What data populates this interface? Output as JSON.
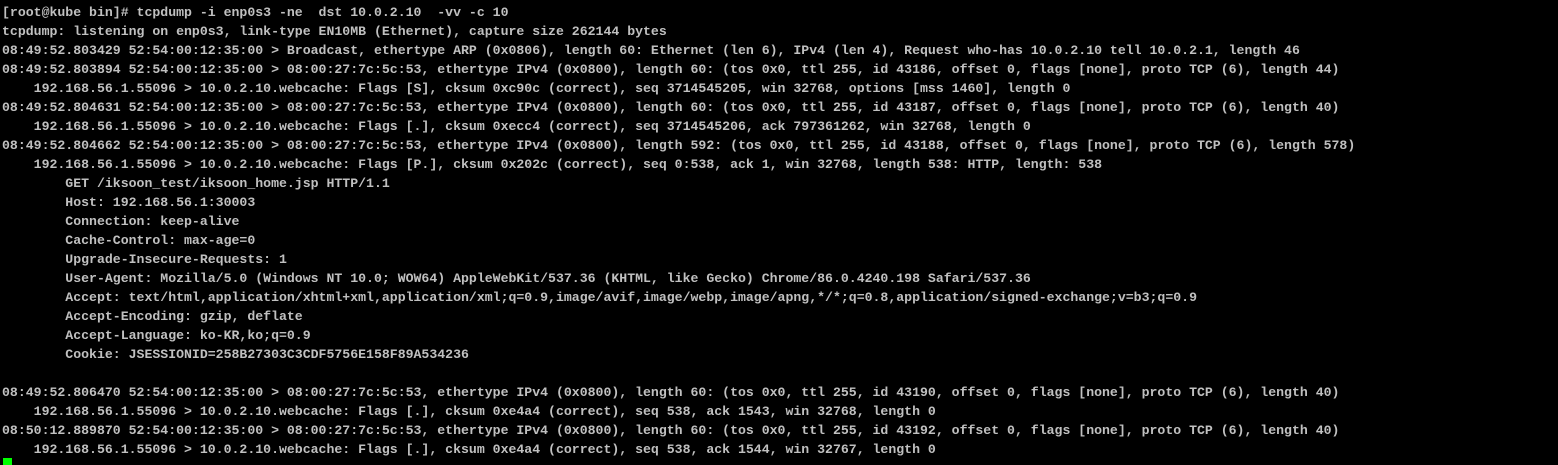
{
  "terminal": {
    "colors": {
      "background": "#000000",
      "foreground": "#c0c0c0",
      "cursor": "#00ff00"
    },
    "lines": [
      "[root@kube bin]# tcpdump -i enp0s3 -ne  dst 10.0.2.10  -vv -c 10",
      "tcpdump: listening on enp0s3, link-type EN10MB (Ethernet), capture size 262144 bytes",
      "08:49:52.803429 52:54:00:12:35:00 > Broadcast, ethertype ARP (0x0806), length 60: Ethernet (len 6), IPv4 (len 4), Request who-has 10.0.2.10 tell 10.0.2.1, length 46",
      "08:49:52.803894 52:54:00:12:35:00 > 08:00:27:7c:5c:53, ethertype IPv4 (0x0800), length 60: (tos 0x0, ttl 255, id 43186, offset 0, flags [none], proto TCP (6), length 44)",
      "    192.168.56.1.55096 > 10.0.2.10.webcache: Flags [S], cksum 0xc90c (correct), seq 3714545205, win 32768, options [mss 1460], length 0",
      "08:49:52.804631 52:54:00:12:35:00 > 08:00:27:7c:5c:53, ethertype IPv4 (0x0800), length 60: (tos 0x0, ttl 255, id 43187, offset 0, flags [none], proto TCP (6), length 40)",
      "    192.168.56.1.55096 > 10.0.2.10.webcache: Flags [.], cksum 0xecc4 (correct), seq 3714545206, ack 797361262, win 32768, length 0",
      "08:49:52.804662 52:54:00:12:35:00 > 08:00:27:7c:5c:53, ethertype IPv4 (0x0800), length 592: (tos 0x0, ttl 255, id 43188, offset 0, flags [none], proto TCP (6), length 578)",
      "    192.168.56.1.55096 > 10.0.2.10.webcache: Flags [P.], cksum 0x202c (correct), seq 0:538, ack 1, win 32768, length 538: HTTP, length: 538",
      "        GET /iksoon_test/iksoon_home.jsp HTTP/1.1",
      "        Host: 192.168.56.1:30003",
      "        Connection: keep-alive",
      "        Cache-Control: max-age=0",
      "        Upgrade-Insecure-Requests: 1",
      "        User-Agent: Mozilla/5.0 (Windows NT 10.0; WOW64) AppleWebKit/537.36 (KHTML, like Gecko) Chrome/86.0.4240.198 Safari/537.36",
      "        Accept: text/html,application/xhtml+xml,application/xml;q=0.9,image/avif,image/webp,image/apng,*/*;q=0.8,application/signed-exchange;v=b3;q=0.9",
      "        Accept-Encoding: gzip, deflate",
      "        Accept-Language: ko-KR,ko;q=0.9",
      "        Cookie: JSESSIONID=258B27303C3CDF5756E158F89A534236",
      "",
      "08:49:52.806470 52:54:00:12:35:00 > 08:00:27:7c:5c:53, ethertype IPv4 (0x0800), length 60: (tos 0x0, ttl 255, id 43190, offset 0, flags [none], proto TCP (6), length 40)",
      "    192.168.56.1.55096 > 10.0.2.10.webcache: Flags [.], cksum 0xe4a4 (correct), seq 538, ack 1543, win 32768, length 0",
      "08:50:12.889870 52:54:00:12:35:00 > 08:00:27:7c:5c:53, ethertype IPv4 (0x0800), length 60: (tos 0x0, ttl 255, id 43192, offset 0, flags [none], proto TCP (6), length 40)",
      "    192.168.56.1.55096 > 10.0.2.10.webcache: Flags [.], cksum 0xe4a4 (correct), seq 538, ack 1544, win 32767, length 0"
    ]
  }
}
